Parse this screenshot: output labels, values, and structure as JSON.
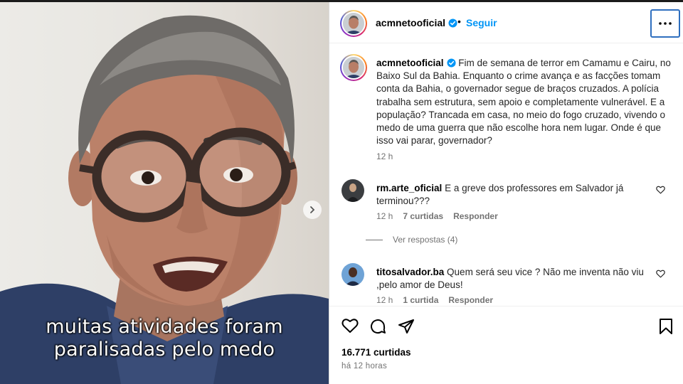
{
  "media": {
    "caption_line1": "muitas atividades foram",
    "caption_line2": "paralisadas pelo medo"
  },
  "header": {
    "username": "acmnetooficial",
    "separator": "•",
    "follow_label": "Seguir"
  },
  "post": {
    "username": "acmnetooficial",
    "caption": "Fim de semana de terror em Camamu e Cairu, no Baixo Sul da Bahia. Enquanto o crime avança e as facções tomam conta da Bahia, o governador segue de braços cruzados. A polícia trabalha sem estrutura, sem apoio e completamente vulnerável. E a população? Trancada em casa, no meio do fogo cruzado, vivendo o medo de uma guerra que não escolhe hora nem lugar. Onde é que isso vai parar, governador?",
    "time": "12 h"
  },
  "comments": [
    {
      "username": "rm.arte_oficial",
      "text": "E a greve dos professores em Salvador já terminou???",
      "time": "12 h",
      "likes": "7 curtidas",
      "reply_label": "Responder"
    },
    {
      "username": "titosalvador.ba",
      "text": "Quem será seu vice ? Não me inventa não viu ,pelo amor de Deus!",
      "time": "12 h",
      "likes": "1 curtida",
      "reply_label": "Responder"
    }
  ],
  "replies_label": "Ver respostas (4)",
  "footer": {
    "likes": "16.771 curtidas",
    "time_ago": "há 12 horas"
  },
  "icons": {
    "verified": "verified-badge-icon",
    "more": "more-options-icon",
    "next": "chevron-right-icon",
    "like": "heart-icon",
    "comment": "comment-icon",
    "share": "share-icon",
    "save": "bookmark-icon"
  },
  "colors": {
    "link_blue": "#0095f6",
    "verified_blue": "#0095f6",
    "text_primary": "#262626",
    "text_secondary": "#737373"
  }
}
